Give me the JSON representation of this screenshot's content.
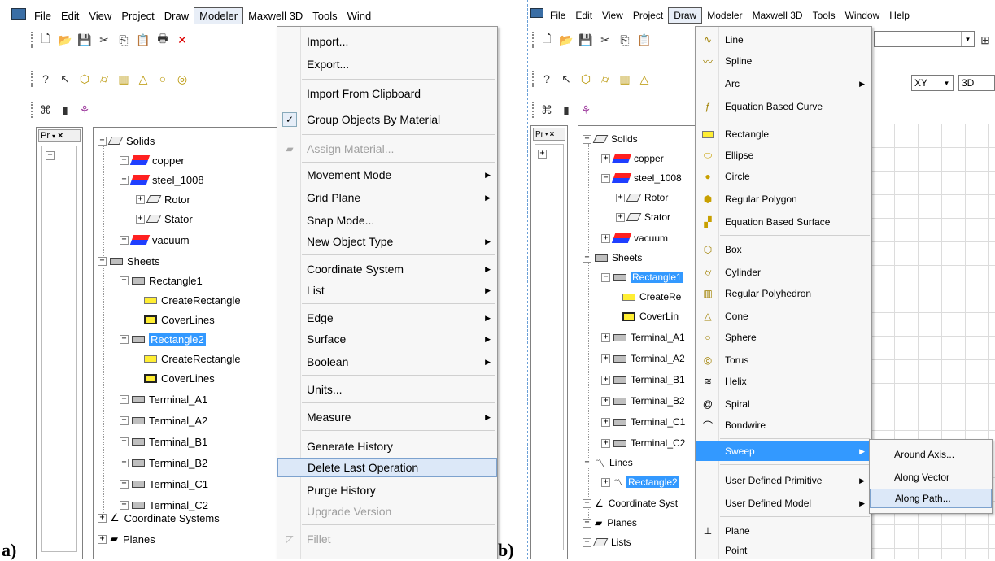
{
  "figure_labels": {
    "a": "a)",
    "b": "b)"
  },
  "panel_a": {
    "menubar": [
      "File",
      "Edit",
      "View",
      "Project",
      "Draw",
      "Modeler",
      "Maxwell 3D",
      "Tools",
      "Wind"
    ],
    "tab_label": "Pr",
    "tree": {
      "solids": "Solids",
      "copper": "copper",
      "steel": "steel_1008",
      "rotor": "Rotor",
      "stator": "Stator",
      "vacuum": "vacuum",
      "sheets": "Sheets",
      "rect1": "Rectangle1",
      "create1": "CreateRectangle",
      "cover1": "CoverLines",
      "rect2": "Rectangle2",
      "create2": "CreateRectangle",
      "cover2": "CoverLines",
      "ta1": "Terminal_A1",
      "ta2": "Terminal_A2",
      "tb1": "Terminal_B1",
      "tb2": "Terminal_B2",
      "tc1": "Terminal_C1",
      "tc2": "Terminal_C2",
      "coord": "Coordinate Systems",
      "planes": "Planes"
    },
    "menu": {
      "import": "Import...",
      "export": "Export...",
      "import_clip": "Import From Clipboard",
      "group": "Group Objects By Material",
      "assign": "Assign Material...",
      "movement": "Movement Mode",
      "grid": "Grid Plane",
      "snap": "Snap Mode...",
      "newobj": "New Object Type",
      "coord": "Coordinate System",
      "list": "List",
      "edge": "Edge",
      "surface": "Surface",
      "boolean": "Boolean",
      "units": "Units...",
      "measure": "Measure",
      "genhist": "Generate History",
      "deletelast": "Delete Last Operation",
      "purge": "Purge History",
      "upgrade": "Upgrade Version",
      "fillet": "Fillet"
    }
  },
  "panel_b": {
    "menubar": [
      "File",
      "Edit",
      "View",
      "Project",
      "Draw",
      "Modeler",
      "Maxwell 3D",
      "Tools",
      "Window",
      "Help"
    ],
    "tab_label": "Pr",
    "plane_combo": "XY",
    "view_combo": "3D",
    "tree": {
      "solids": "Solids",
      "copper": "copper",
      "steel": "steel_1008",
      "rotor": "Rotor",
      "stator": "Stator",
      "vacuum": "vacuum",
      "sheets": "Sheets",
      "rect1": "Rectangle1",
      "create1": "CreateRe",
      "cover1": "CoverLin",
      "ta1": "Terminal_A1",
      "ta2": "Terminal_A2",
      "tb1": "Terminal_B1",
      "tb2": "Terminal_B2",
      "tc1": "Terminal_C1",
      "tc2": "Terminal_C2",
      "lines": "Lines",
      "rect2": "Rectangle2",
      "coord": "Coordinate Syst",
      "planes": "Planes",
      "lists": "Lists"
    },
    "draw_menu": {
      "line": "Line",
      "spline": "Spline",
      "arc": "Arc",
      "eqcurve": "Equation Based Curve",
      "rectangle": "Rectangle",
      "ellipse": "Ellipse",
      "circle": "Circle",
      "regpoly": "Regular Polygon",
      "eqsurf": "Equation Based Surface",
      "box": "Box",
      "cylinder": "Cylinder",
      "regpolyhedron": "Regular Polyhedron",
      "cone": "Cone",
      "sphere": "Sphere",
      "torus": "Torus",
      "helix": "Helix",
      "spiral": "Spiral",
      "bondwire": "Bondwire",
      "sweep": "Sweep",
      "udp": "User Defined Primitive",
      "udm": "User Defined Model",
      "plane": "Plane",
      "point": "Point"
    },
    "sweep_menu": {
      "axis": "Around Axis...",
      "vector": "Along Vector",
      "path": "Along Path..."
    }
  }
}
